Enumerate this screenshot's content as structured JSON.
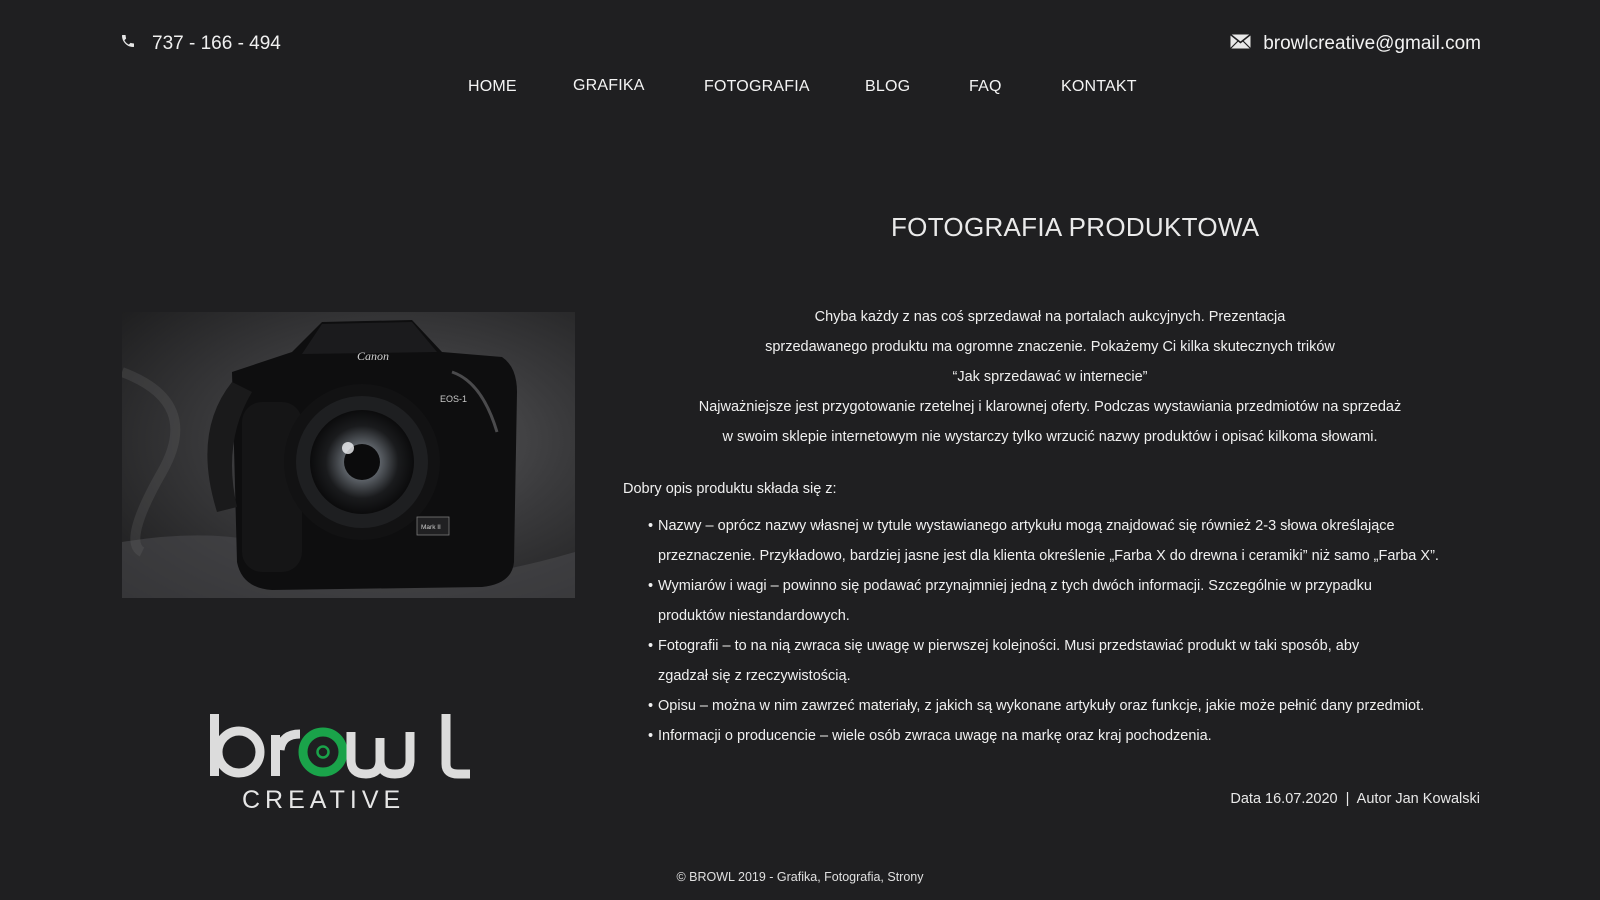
{
  "header": {
    "phone": "737 - 166 - 494",
    "email": "browlcreative@gmail.com",
    "icons": {
      "phone": "phone-icon",
      "email": "envelope-icon"
    }
  },
  "nav": [
    {
      "label": "HOME"
    },
    {
      "label": "GRAFIKA"
    },
    {
      "label": "FOTOGRAFIA"
    },
    {
      "label": "BLOG"
    },
    {
      "label": "FAQ"
    },
    {
      "label": "KONTAKT"
    }
  ],
  "article": {
    "title": "FOTOGRAFIA PRODUKTOWA",
    "intro": [
      "Chyba każdy z nas coś sprzedawał na portalach aukcyjnych. Prezentacja",
      "sprzedawanego produktu ma ogromne znaczenie. Pokażemy Ci kilka skutecznych trików",
      "“Jak sprzedawać w internecie”",
      "Najważniejsze jest przygotowanie rzetelnej i klarownej oferty. Podczas wystawiania przedmiotów na sprzedaż",
      "w swoim sklepie internetowym nie wystarczy tylko wrzucić nazwy produktów i opisać kilkoma słowami."
    ],
    "list_heading": "Dobry opis produktu składa się z:",
    "bullets": [
      "Nazwy – oprócz nazwy własnej w tytule wystawianego artykułu mogą znajdować się również 2-3 słowa określające przeznaczenie. Przykładowo, bardziej jasne jest dla klienta określenie „Farba X do drewna i ceramiki”  niż samo „Farba X”.",
      "Wymiarów i wagi – powinno się podawać przynajmniej jedną z tych dwóch informacji. Szczególnie w przypadku produktów niestandardowych.",
      "Fotografii – to na nią zwraca się uwagę w pierwszej kolejności. Musi przedstawiać produkt w taki sposób, aby zgadzał się z rzeczywistością.",
      "Opisu – można w nim zawrzeć materiały, z jakich są wykonane artykuły oraz funkcje, jakie może pełnić dany przedmiot.",
      "Informacji o producencie – wiele osób zwraca uwagę na markę oraz kraj pochodzenia."
    ],
    "meta": "Data 16.07.2020  |  Autor Jan Kowalski"
  },
  "image": {
    "camera_brand": "Canon",
    "camera_model": "EOS-1",
    "badge": "Mark II"
  },
  "logo": {
    "word": "browl",
    "sub": "CREATIVE",
    "accent": "#1aa34a"
  },
  "footer": "©  BROWL 2019 - Grafika, Fotografia, Strony",
  "colors": {
    "background": "#1f1f21",
    "text": "#f0f0f0",
    "logo_gray": "#d9d9d9",
    "logo_green": "#1aa34a"
  }
}
